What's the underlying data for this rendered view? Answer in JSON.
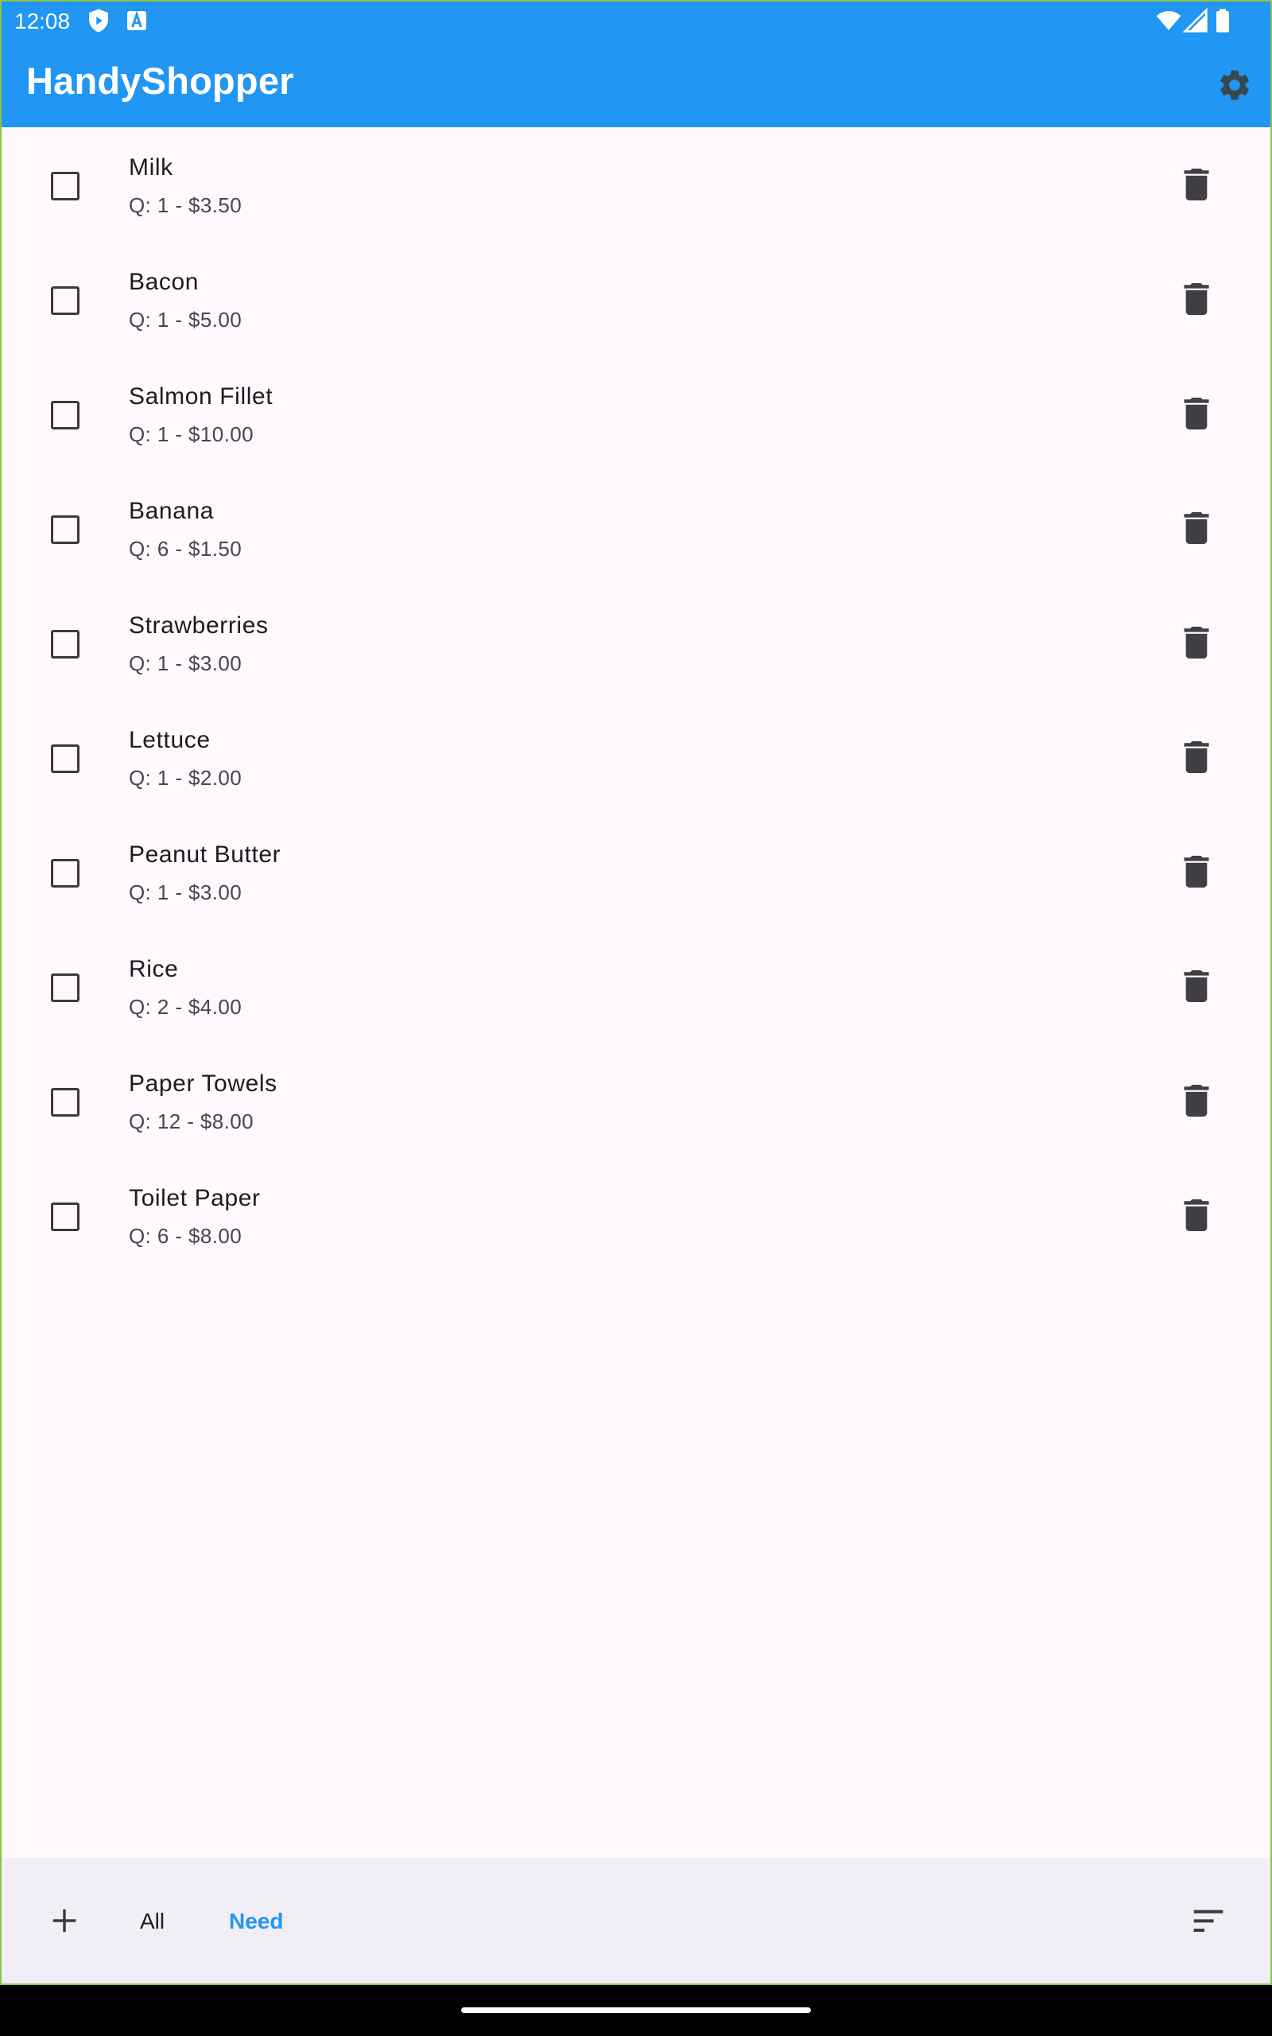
{
  "status_bar": {
    "time": "12:08",
    "left_icons": [
      "shield-play-icon",
      "font-a-icon"
    ],
    "right_icons": [
      "wifi-icon",
      "signal-icon",
      "battery-icon"
    ]
  },
  "app_bar": {
    "title": "HandyShopper",
    "color": "#2196F3",
    "action_icon": "gear-icon"
  },
  "items": [
    {
      "name": "Milk",
      "detail": "Q: 1 - $3.50",
      "checked": false
    },
    {
      "name": "Bacon",
      "detail": "Q: 1 - $5.00",
      "checked": false
    },
    {
      "name": "Salmon Fillet",
      "detail": "Q: 1 - $10.00",
      "checked": false
    },
    {
      "name": "Banana",
      "detail": "Q: 6 - $1.50",
      "checked": false
    },
    {
      "name": "Strawberries",
      "detail": "Q: 1 - $3.00",
      "checked": false
    },
    {
      "name": "Lettuce",
      "detail": "Q: 1 - $2.00",
      "checked": false
    },
    {
      "name": "Peanut Butter",
      "detail": "Q: 1 - $3.00",
      "checked": false
    },
    {
      "name": "Rice",
      "detail": "Q: 2 - $4.00",
      "checked": false
    },
    {
      "name": "Paper Towels",
      "detail": "Q: 12 - $8.00",
      "checked": false
    },
    {
      "name": "Toilet Paper",
      "detail": "Q: 6 - $8.00",
      "checked": false
    }
  ],
  "bottom_bar": {
    "add_icon": "plus-icon",
    "tabs": [
      {
        "label": "All",
        "active": false
      },
      {
        "label": "Need",
        "active": true
      }
    ],
    "sort_icon": "sort-icon",
    "active_color": "#2196F3"
  }
}
